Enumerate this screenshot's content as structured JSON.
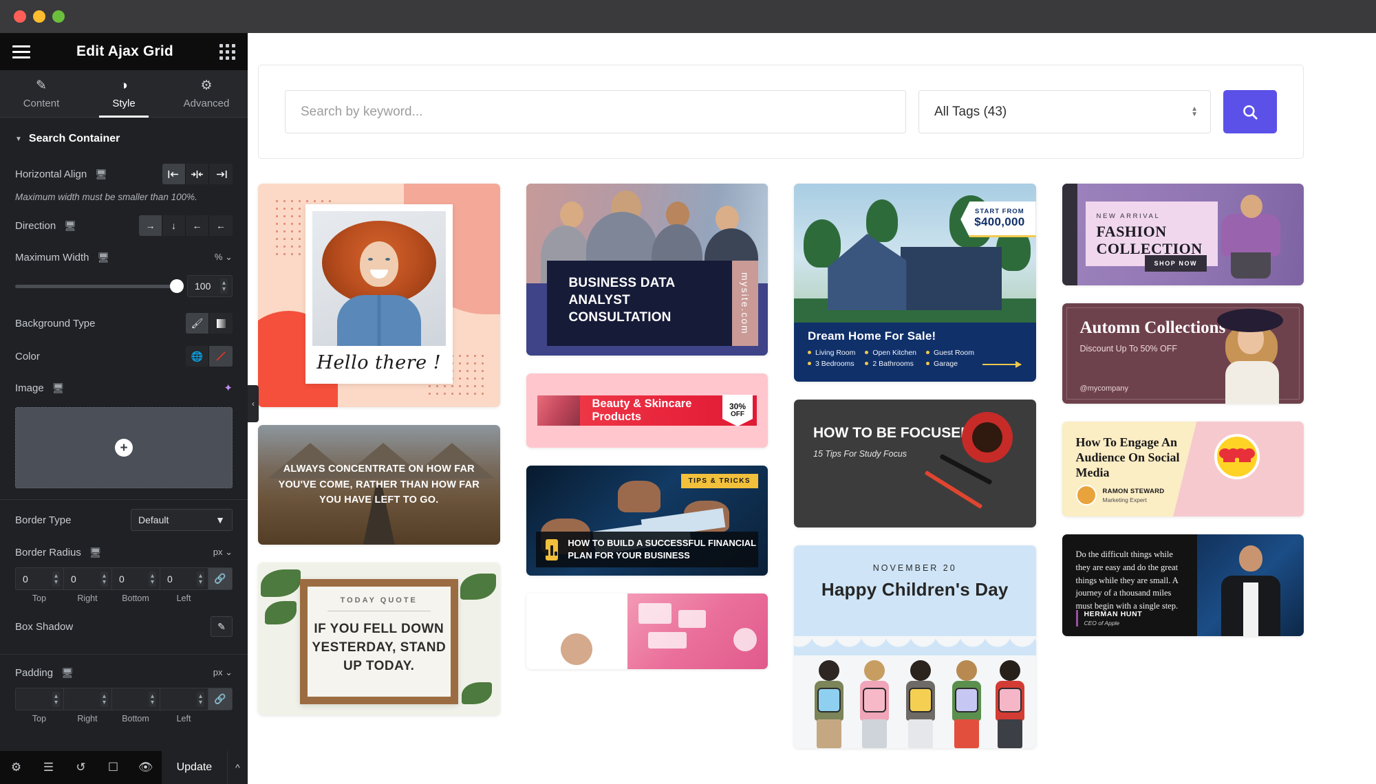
{
  "window": {
    "traffic_lights": [
      "close",
      "minimize",
      "maximize"
    ]
  },
  "panel": {
    "title": "Edit Ajax Grid",
    "menu_icon": "hamburger-icon",
    "apps_icon": "grid-apps-icon",
    "tabs": [
      {
        "label": "Content",
        "icon": "pencil-icon",
        "active": false
      },
      {
        "label": "Style",
        "icon": "contrast-icon",
        "active": true
      },
      {
        "label": "Advanced",
        "icon": "gear-icon",
        "active": false
      }
    ],
    "section": {
      "title": "Search Container",
      "collapsed": false
    },
    "controls": {
      "horizontal_align": {
        "label": "Horizontal Align",
        "device_icon": "desktop-icon",
        "options": [
          "align-start",
          "align-center",
          "align-end"
        ],
        "glyphs": [
          "|←",
          "→|←",
          "→|"
        ],
        "selected_index": 0
      },
      "hint": "Maximum width must be smaller than 100%.",
      "direction": {
        "label": "Direction",
        "device_icon": "desktop-icon",
        "glyphs": [
          "→",
          "↓",
          "←",
          "←"
        ],
        "selected_index": 0
      },
      "maximum_width": {
        "label": "Maximum Width",
        "device_icon": "desktop-icon",
        "unit": "%",
        "value": "100",
        "slider_percent": 100
      },
      "background_type": {
        "label": "Background Type",
        "options": [
          "classic-brush-icon",
          "gradient-icon"
        ],
        "selected_index": 0
      },
      "color": {
        "label": "Color",
        "options": [
          "globe-icon",
          "no-color-icon"
        ],
        "selected_index": 1
      },
      "image": {
        "label": "Image",
        "device_icon": "desktop-icon",
        "ai_icon": "ai-sparkle-icon",
        "add_glyph": "+"
      },
      "border_type": {
        "label": "Border Type",
        "value": "Default",
        "caret": "▼"
      },
      "border_radius": {
        "label": "Border Radius",
        "device_icon": "desktop-icon",
        "unit": "px",
        "values": [
          "0",
          "0",
          "0",
          "0"
        ],
        "side_labels": [
          "Top",
          "Right",
          "Bottom",
          "Left"
        ],
        "link_icon": "link-icon"
      },
      "box_shadow": {
        "label": "Box Shadow",
        "edit_icon": "pencil-edit-icon"
      },
      "padding": {
        "label": "Padding",
        "device_icon": "desktop-icon",
        "unit": "px",
        "values": [
          "",
          "",
          "",
          ""
        ],
        "side_labels": [
          "Top",
          "Right",
          "Bottom",
          "Left"
        ],
        "link_icon": "link-icon"
      }
    },
    "footer": {
      "icons": [
        "gear-icon",
        "layers-icon",
        "history-icon",
        "responsive-icon",
        "preview-eye-icon"
      ],
      "update_label": "Update",
      "caret_glyph": "⌃"
    },
    "collapse_handle_glyph": "‹"
  },
  "canvas": {
    "search": {
      "placeholder": "Search by keyword...",
      "value": "",
      "tag_select_value": "All Tags (43)",
      "search_button_icon": "search-icon",
      "accent_color": "#5b51e8"
    },
    "grid": {
      "columns": [
        {
          "cards": [
            {
              "name": "card-hello-there",
              "type": "hello",
              "caption": "Hello there !"
            },
            {
              "name": "card-road-quote",
              "type": "road",
              "quote": "ALWAYS CONCENTRATE ON HOW FAR YOU'VE COME, RATHER THAN HOW FAR YOU HAVE LEFT TO GO."
            },
            {
              "name": "card-today-quote",
              "type": "today",
              "label": "TODAY QUOTE",
              "message": "IF YOU FELL DOWN YESTERDAY, STAND UP TODAY."
            }
          ]
        },
        {
          "cards": [
            {
              "name": "card-business-data",
              "type": "business",
              "title": "BUSINESS DATA ANALYST CONSULTATION",
              "site": "mysite.com"
            },
            {
              "name": "card-beauty-skincare",
              "type": "beauty",
              "title": "Beauty & Skincare Products",
              "badge_percent": "30%",
              "badge_off": "OFF"
            },
            {
              "name": "card-financial-plan",
              "type": "financial",
              "tag": "TIPS & TRICKS",
              "title": "HOW TO BUILD A SUCCESSFUL FINANCIAL PLAN FOR YOUR BUSINESS"
            },
            {
              "name": "card-makeup-influencer",
              "type": "makeup"
            }
          ]
        },
        {
          "cards": [
            {
              "name": "card-dream-home",
              "type": "home",
              "badge_label": "START FROM",
              "badge_price": "$400,000",
              "title": "Dream Home For Sale!",
              "features": [
                "Living Room",
                "Open Kitchen",
                "Guest Room",
                "3 Bedrooms",
                "2 Bathrooms",
                "Garage"
              ]
            },
            {
              "name": "card-how-to-be-focused",
              "type": "focus",
              "title": "HOW TO BE FOCUSED",
              "subtitle": "15 Tips For Study Focus"
            },
            {
              "name": "card-childrens-day",
              "type": "kids",
              "date": "NOVEMBER 20",
              "title": "Happy Children's Day"
            }
          ]
        },
        {
          "cards": [
            {
              "name": "card-fashion-collection",
              "type": "fashion",
              "kicker": "NEW ARRIVAL",
              "title": "FASHION COLLECTION",
              "cta": "SHOP NOW"
            },
            {
              "name": "card-autumn-collections",
              "type": "autumn",
              "title": "Automn Collections",
              "subtitle": "Discount Up To 50% OFF",
              "handle": "@mycompany"
            },
            {
              "name": "card-social-media",
              "type": "social",
              "title": "How To Engage An Audience On Social Media",
              "author": "RAMON STEWARD",
              "role": "Marketing Expert"
            },
            {
              "name": "card-herman-hunt-quote",
              "type": "quote",
              "quote": "Do the difficult things while they are easy and do the great things while they are small. A journey of a thousand miles must begin with a single step.",
              "author": "HERMAN HUNT",
              "role": "CEO of Apple"
            }
          ]
        }
      ]
    }
  }
}
